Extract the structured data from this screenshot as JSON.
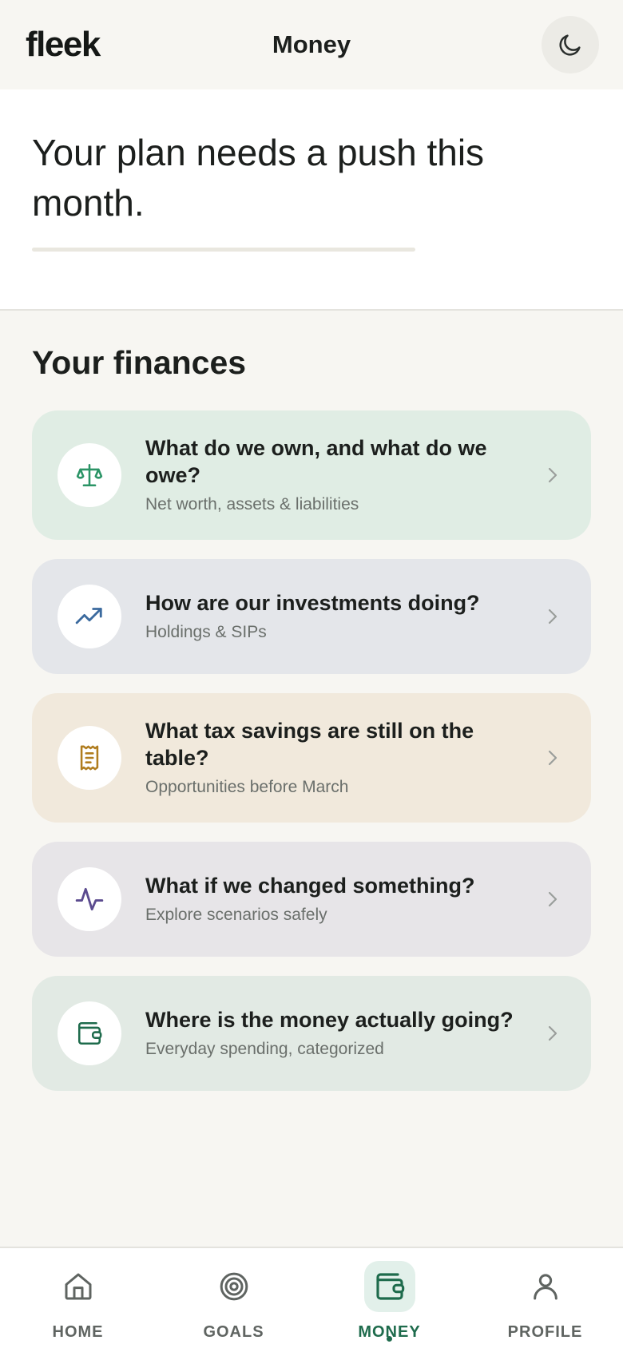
{
  "app": {
    "logo": "fleek",
    "page_title": "Money"
  },
  "hero": {
    "title": "Your plan needs a push this month."
  },
  "finances": {
    "section_title": "Your finances",
    "cards": [
      {
        "title": "What do we own, and what do we owe?",
        "subtitle": "Net worth, assets & liabilities",
        "icon": "scale-icon",
        "bg": "#e0ede4",
        "accent": "#2b9466"
      },
      {
        "title": "How are our investments doing?",
        "subtitle": "Holdings & SIPs",
        "icon": "trending-up-icon",
        "bg": "#e4e6ea",
        "accent": "#3b6a9e"
      },
      {
        "title": "What tax savings are still on the table?",
        "subtitle": "Opportunities before March",
        "icon": "receipt-icon",
        "bg": "#f1e9dc",
        "accent": "#b07d1f"
      },
      {
        "title": "What if we changed something?",
        "subtitle": "Explore scenarios safely",
        "icon": "activity-icon",
        "bg": "#e7e5e8",
        "accent": "#5b4b8f"
      },
      {
        "title": "Where is the money actually going?",
        "subtitle": "Everyday spending, categorized",
        "icon": "wallet-icon",
        "bg": "#e2eae4",
        "accent": "#1e6b4c"
      }
    ]
  },
  "nav": {
    "items": [
      {
        "label": "HOME",
        "icon": "home-icon",
        "active": false
      },
      {
        "label": "GOALS",
        "icon": "target-icon",
        "active": false
      },
      {
        "label": "MONEY",
        "icon": "wallet-icon",
        "active": true
      },
      {
        "label": "PROFILE",
        "icon": "user-icon",
        "active": false
      }
    ]
  },
  "colors": {
    "brand_green": "#1e6b4c",
    "background": "#f7f6f2"
  }
}
